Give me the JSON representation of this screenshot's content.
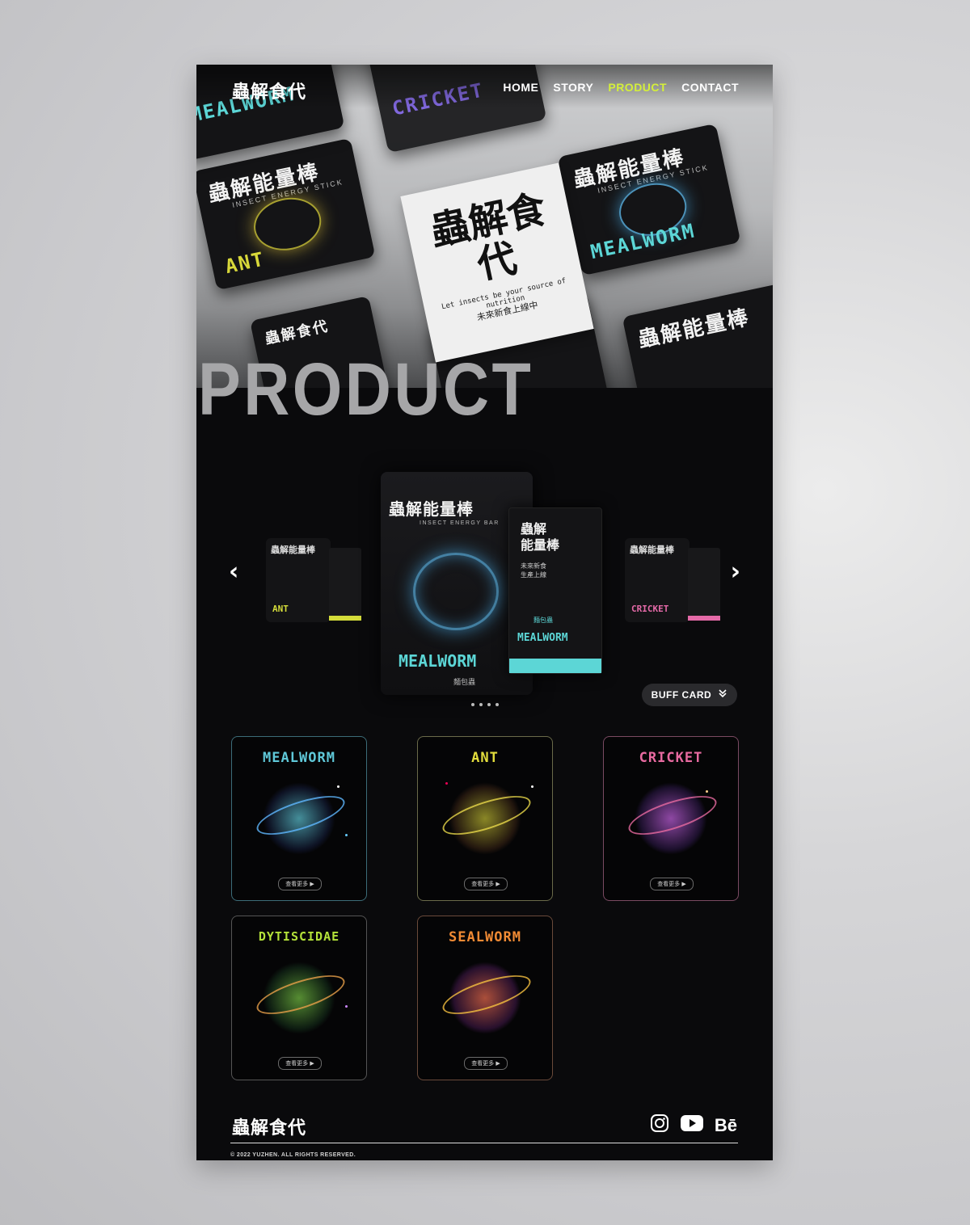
{
  "brand": {
    "logo": "蟲解食代"
  },
  "nav": {
    "items": [
      "HOME",
      "STORY",
      "PRODUCT",
      "CONTACT"
    ],
    "active": "PRODUCT",
    "active_color": "#d4ef3a"
  },
  "hero": {
    "center_logo": "蟲解食代",
    "center_tagline": "Let insects be your source of nutrition",
    "center_cn": "未來新食上線中",
    "pack_title": "蟲解能量棒",
    "pack_sub": "INSECT ENERGY STICK",
    "pack_names": [
      "ANT",
      "MEALWORM",
      "CRICKET"
    ],
    "page_title": "PRODUCT"
  },
  "carousel": {
    "prev_icon": "chevron-left-icon",
    "next_icon": "chevron-right-icon",
    "main": {
      "bag_title": "蟲解能量棒",
      "bag_sub": "INSECT ENERGY BAR",
      "bag_name": "MEALWORM",
      "bag_cn": "麵包蟲",
      "box_title_1": "蟲解",
      "box_title_2": "能量棒",
      "box_cn_1": "未來新食",
      "box_cn_2": "生產上線",
      "box_label": "麵包蟲",
      "box_name": "MEALWORM"
    },
    "left": {
      "title": "蟲解能量棒",
      "name": "ANT",
      "accent": "#d4dc3a"
    },
    "right": {
      "title": "蟲解能量棒",
      "name": "CRICKET",
      "accent": "#e56aa8"
    },
    "dots_count": 4,
    "buff_card_label": "BUFF CARD",
    "buff_card_icon": "double-chevron-down-icon"
  },
  "cards": [
    {
      "name": "MEALWORM",
      "color": "#5fc8d8",
      "button": "查看更多 ▶"
    },
    {
      "name": "ANT",
      "color": "#e2dd3c",
      "button": "查看更多 ▶"
    },
    {
      "name": "CRICKET",
      "color": "#e86aa0",
      "button": "查看更多 ▶"
    },
    {
      "name": "DYTISCIDAE",
      "color": "#b4e23a",
      "button": "查看更多 ▶"
    },
    {
      "name": "SEALWORM",
      "color": "#f08a34",
      "button": "查看更多 ▶"
    }
  ],
  "footer": {
    "logo": "蟲解食代",
    "socials": [
      "instagram-icon",
      "youtube-icon",
      "behance-icon"
    ],
    "behance_text": "Bē",
    "copyright": "© 2022 YUZHEN. ALL RIGHTS RESERVED."
  }
}
